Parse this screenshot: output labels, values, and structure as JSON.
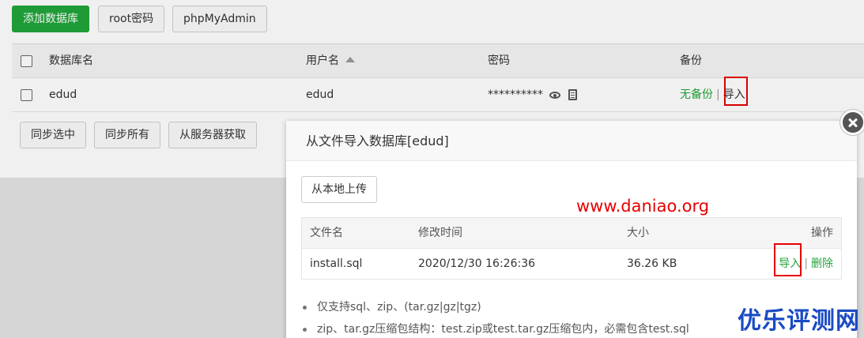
{
  "toolbar": {
    "add_db_label": "添加数据库",
    "root_pwd_label": "root密码",
    "phpmyadmin_label": "phpMyAdmin"
  },
  "db_table": {
    "headers": {
      "name": "数据库名",
      "user": "用户名",
      "password": "密码",
      "backup": "备份"
    },
    "rows": [
      {
        "name": "edud",
        "user": "edud",
        "password": "**********",
        "backup_status": "无备份",
        "separator": "|",
        "import_label": "导入"
      }
    ]
  },
  "bottom_buttons": {
    "sync_selected": "同步选中",
    "sync_all": "同步所有",
    "fetch_from_server": "从服务器获取"
  },
  "modal": {
    "title": "从文件导入数据库[edud]",
    "upload_label": "从本地上传",
    "watermark_url": "www.daniao.org",
    "file_table": {
      "headers": {
        "filename": "文件名",
        "modified": "修改时间",
        "size": "大小",
        "actions": "操作"
      },
      "rows": [
        {
          "filename": "install.sql",
          "modified": "2020/12/30 16:26:36",
          "size": "36.26 KB",
          "import_label": "导入",
          "separator": "|",
          "delete_label": "删除"
        }
      ]
    },
    "tips": [
      "仅支持sql、zip、(tar.gz|gz|tgz)",
      "zip、tar.gz压缩包结构：test.zip或test.tar.gz压缩包内，必需包含test.sql"
    ]
  },
  "site_watermark": "优乐评测网",
  "colors": {
    "accent_green": "#20a53a",
    "highlight_red": "#e60000",
    "watermark_blue": "#1a4bc4"
  }
}
